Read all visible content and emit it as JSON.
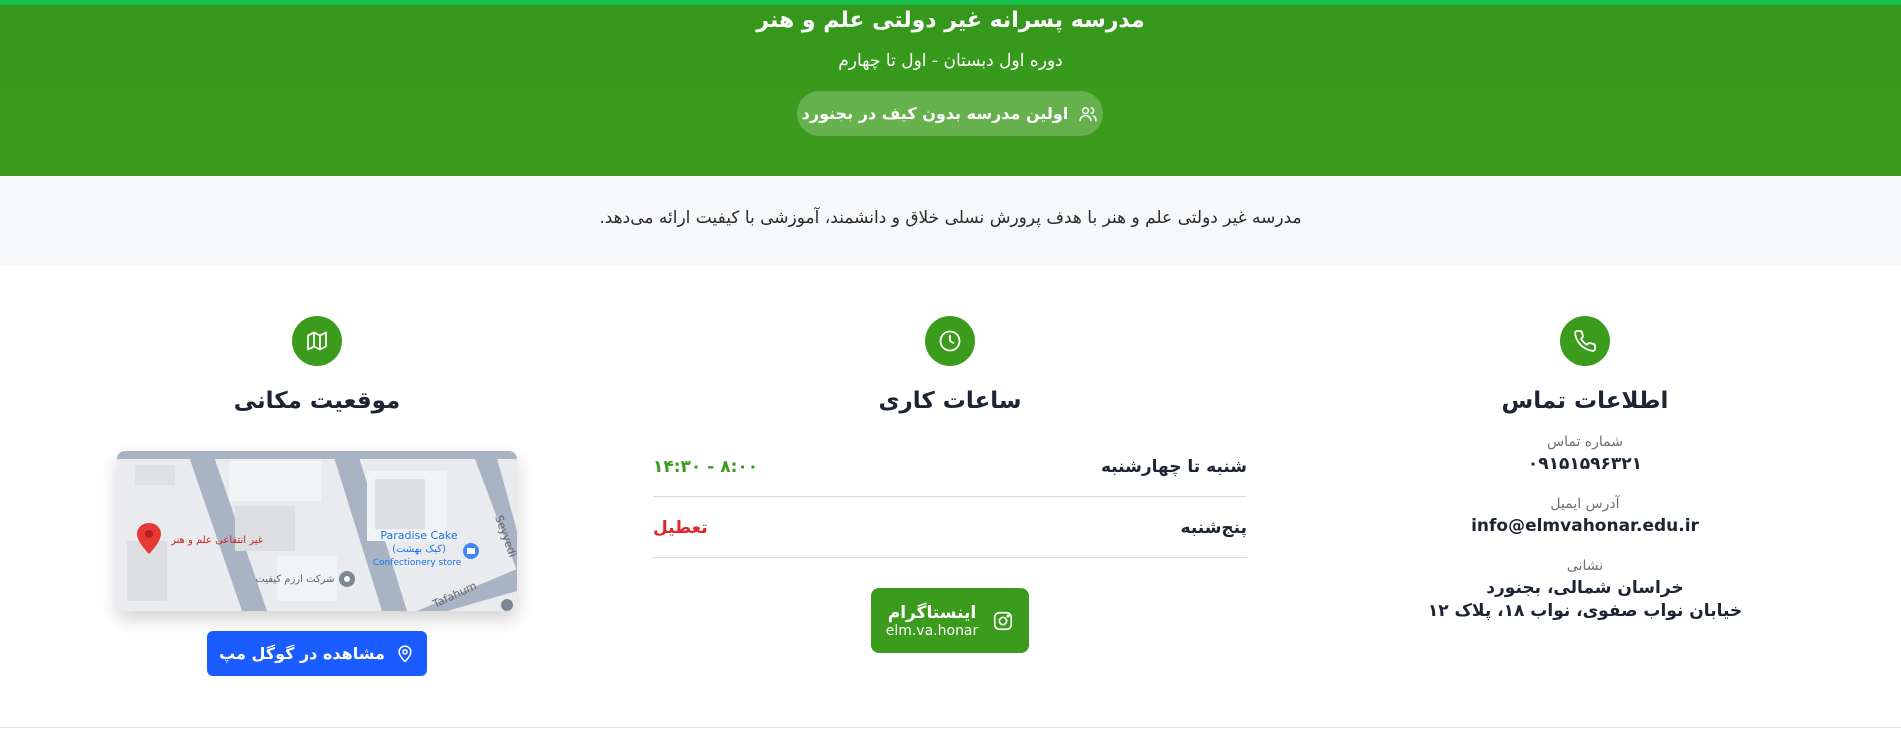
{
  "hero": {
    "title": "مدرسه پسرانه غیر دولتی علم و هنر",
    "subtitle": "دوره اول دبستان - اول تا چهارم",
    "badge": "اولین مدرسه بدون کیف در بجنورد",
    "badge_icon": "users-icon"
  },
  "about": {
    "text": "مدرسه غیر دولتی علم و هنر با هدف پرورش نسلی خلاق و دانشمند، آموزشی با کیفیت ارائه می‌دهد."
  },
  "contact": {
    "title": "اطلاعات تماس",
    "icon": "phone-icon",
    "phone_label": "شماره تماس",
    "phone": "۰۹۱۵۱۵۹۶۳۲۱",
    "email_label": "آدرس ایمیل",
    "email": "info@elmvahonar.edu.ir",
    "address_label": "نشانی",
    "address_line1": "خراسان شمالی، بجنورد",
    "address_line2": "خیابان نواب صفوی، نواب ۱۸، پلاک ۱۲"
  },
  "hours": {
    "title": "ساعات کاری",
    "icon": "clock-icon",
    "rows": [
      {
        "day": "شنبه تا چهارشنبه",
        "time": "۸:۰۰ - ۱۴:۳۰",
        "color": "#3a9b1c"
      },
      {
        "day": "پنج‌شنبه",
        "time": "تعطیل",
        "color": "#e0262b"
      }
    ],
    "instagram_label": "اینستاگرام",
    "instagram_handle": "elm.va.honar",
    "instagram_icon": "instagram-icon"
  },
  "location": {
    "title": "موقعیت مکانی",
    "icon": "map-icon",
    "map_labels": {
      "school": "غیر انتفاعی علم و هنر",
      "cake_en": "Paradise Cake",
      "cake_fa": "(کیک بهشت)",
      "cake_type": "Confectionery store",
      "company": "شرکت ارزم کیفیت",
      "street1": "Seyyedi",
      "street2": "Tafahum"
    },
    "button": "مشاهده در گوگل مپ",
    "button_icon": "map-pin-icon"
  },
  "colors": {
    "primary_green": "#3a9b1c",
    "accent_blue": "#1a5cff",
    "closed_red": "#e0262b"
  }
}
